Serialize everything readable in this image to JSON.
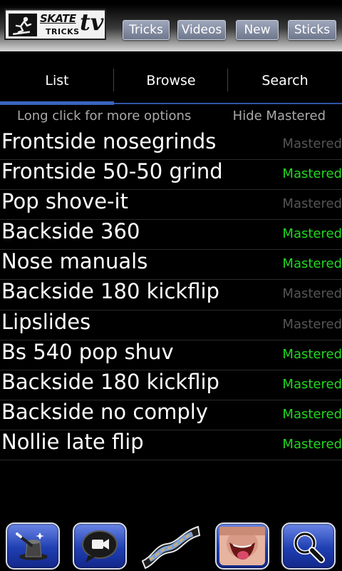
{
  "logo": {
    "line1": "SKATE",
    "line2": "TRICKS",
    "line3": "tv"
  },
  "topnav": [
    {
      "label": "Tricks"
    },
    {
      "label": "Videos"
    },
    {
      "label": "New"
    },
    {
      "label": "Sticks"
    }
  ],
  "tabs": [
    {
      "label": "List",
      "active": true
    },
    {
      "label": "Browse",
      "active": false
    },
    {
      "label": "Search",
      "active": false
    }
  ],
  "subbar": {
    "hint": "Long click for more options",
    "toggle": "Hide Mastered"
  },
  "colors": {
    "mastered_on": "#22d822",
    "mastered_off": "#555555",
    "accent": "#3a64c0"
  },
  "tricks": [
    {
      "name": "Frontside nosegrinds",
      "status": "Mastered",
      "mastered": false
    },
    {
      "name": "Frontside 50-50 grind",
      "status": "Mastered",
      "mastered": true
    },
    {
      "name": "Pop shove-it",
      "status": "Mastered",
      "mastered": false
    },
    {
      "name": "Backside 360",
      "status": "Mastered",
      "mastered": true
    },
    {
      "name": "Nose manuals",
      "status": "Mastered",
      "mastered": true
    },
    {
      "name": "Backside 180 kickflip",
      "status": "Mastered",
      "mastered": false
    },
    {
      "name": "Lipslides",
      "status": "Mastered",
      "mastered": false
    },
    {
      "name": "Bs 540 pop shuv",
      "status": "Mastered",
      "mastered": true
    },
    {
      "name": "Backside 180 kickflip",
      "status": "Mastered",
      "mastered": true
    },
    {
      "name": "Backside no comply",
      "status": "Mastered",
      "mastered": true
    },
    {
      "name": "Nollie late flip",
      "status": "Mastered",
      "mastered": true
    }
  ],
  "dock": [
    {
      "icon": "magic-hat-icon"
    },
    {
      "icon": "video-chat-icon"
    },
    {
      "icon": "film-strip-icon"
    },
    {
      "icon": "face-photo-icon"
    },
    {
      "icon": "search-icon"
    }
  ]
}
